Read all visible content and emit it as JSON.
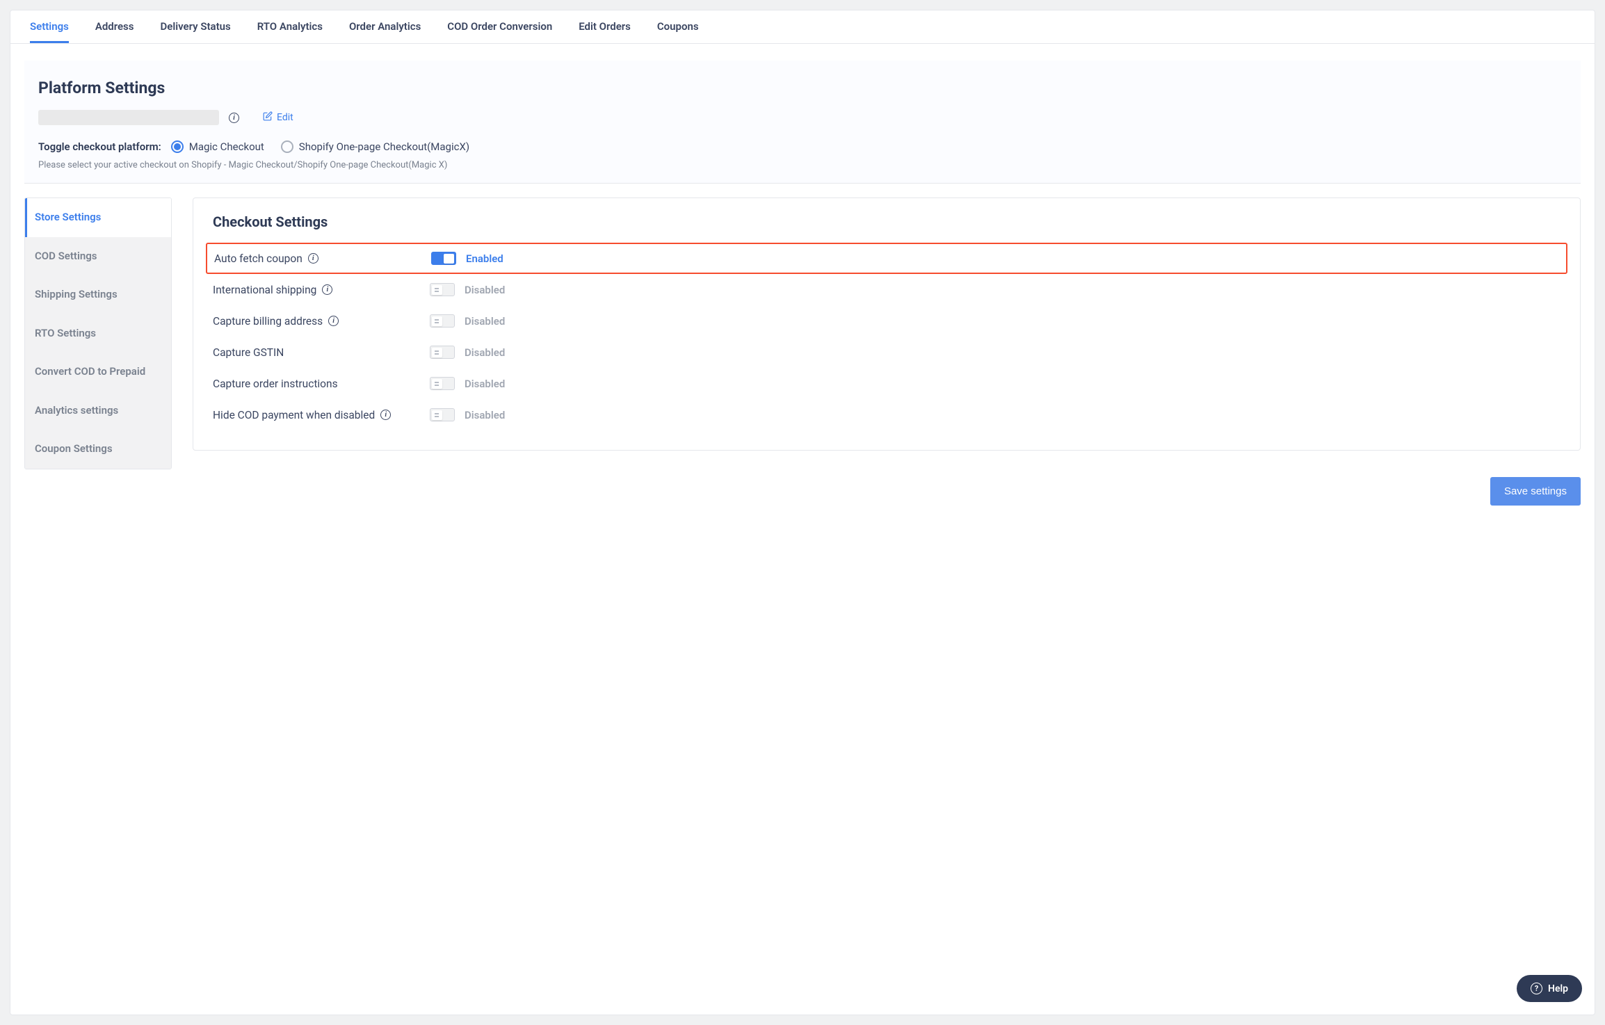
{
  "top_tabs": [
    {
      "label": "Settings",
      "active": true
    },
    {
      "label": "Address",
      "active": false
    },
    {
      "label": "Delivery Status",
      "active": false
    },
    {
      "label": "RTO Analytics",
      "active": false
    },
    {
      "label": "Order Analytics",
      "active": false
    },
    {
      "label": "COD Order Conversion",
      "active": false
    },
    {
      "label": "Edit Orders",
      "active": false
    },
    {
      "label": "Coupons",
      "active": false
    }
  ],
  "platform": {
    "title": "Platform Settings",
    "edit_label": "Edit",
    "toggle_label": "Toggle checkout platform:",
    "radio1": "Magic Checkout",
    "radio2": "Shopify One-page Checkout(MagicX)",
    "description": "Please select your active checkout on Shopify - Magic Checkout/Shopify One-page Checkout(Magic X)"
  },
  "sidebar": {
    "items": [
      {
        "label": "Store Settings",
        "active": true
      },
      {
        "label": "COD Settings",
        "active": false
      },
      {
        "label": "Shipping Settings",
        "active": false
      },
      {
        "label": "RTO Settings",
        "active": false
      },
      {
        "label": "Convert COD to Prepaid",
        "active": false
      },
      {
        "label": "Analytics settings",
        "active": false
      },
      {
        "label": "Coupon Settings",
        "active": false
      }
    ]
  },
  "checkout": {
    "title": "Checkout Settings",
    "rows": [
      {
        "label": "Auto fetch coupon",
        "has_info": true,
        "enabled": true,
        "status": "Enabled",
        "highlighted": true
      },
      {
        "label": "International shipping",
        "has_info": true,
        "enabled": false,
        "status": "Disabled",
        "highlighted": false
      },
      {
        "label": "Capture billing address",
        "has_info": true,
        "enabled": false,
        "status": "Disabled",
        "highlighted": false
      },
      {
        "label": "Capture GSTIN",
        "has_info": false,
        "enabled": false,
        "status": "Disabled",
        "highlighted": false
      },
      {
        "label": "Capture order instructions",
        "has_info": false,
        "enabled": false,
        "status": "Disabled",
        "highlighted": false
      },
      {
        "label": "Hide COD payment when disabled",
        "has_info": true,
        "enabled": false,
        "status": "Disabled",
        "highlighted": false
      }
    ]
  },
  "save_label": "Save settings",
  "help_label": "Help"
}
